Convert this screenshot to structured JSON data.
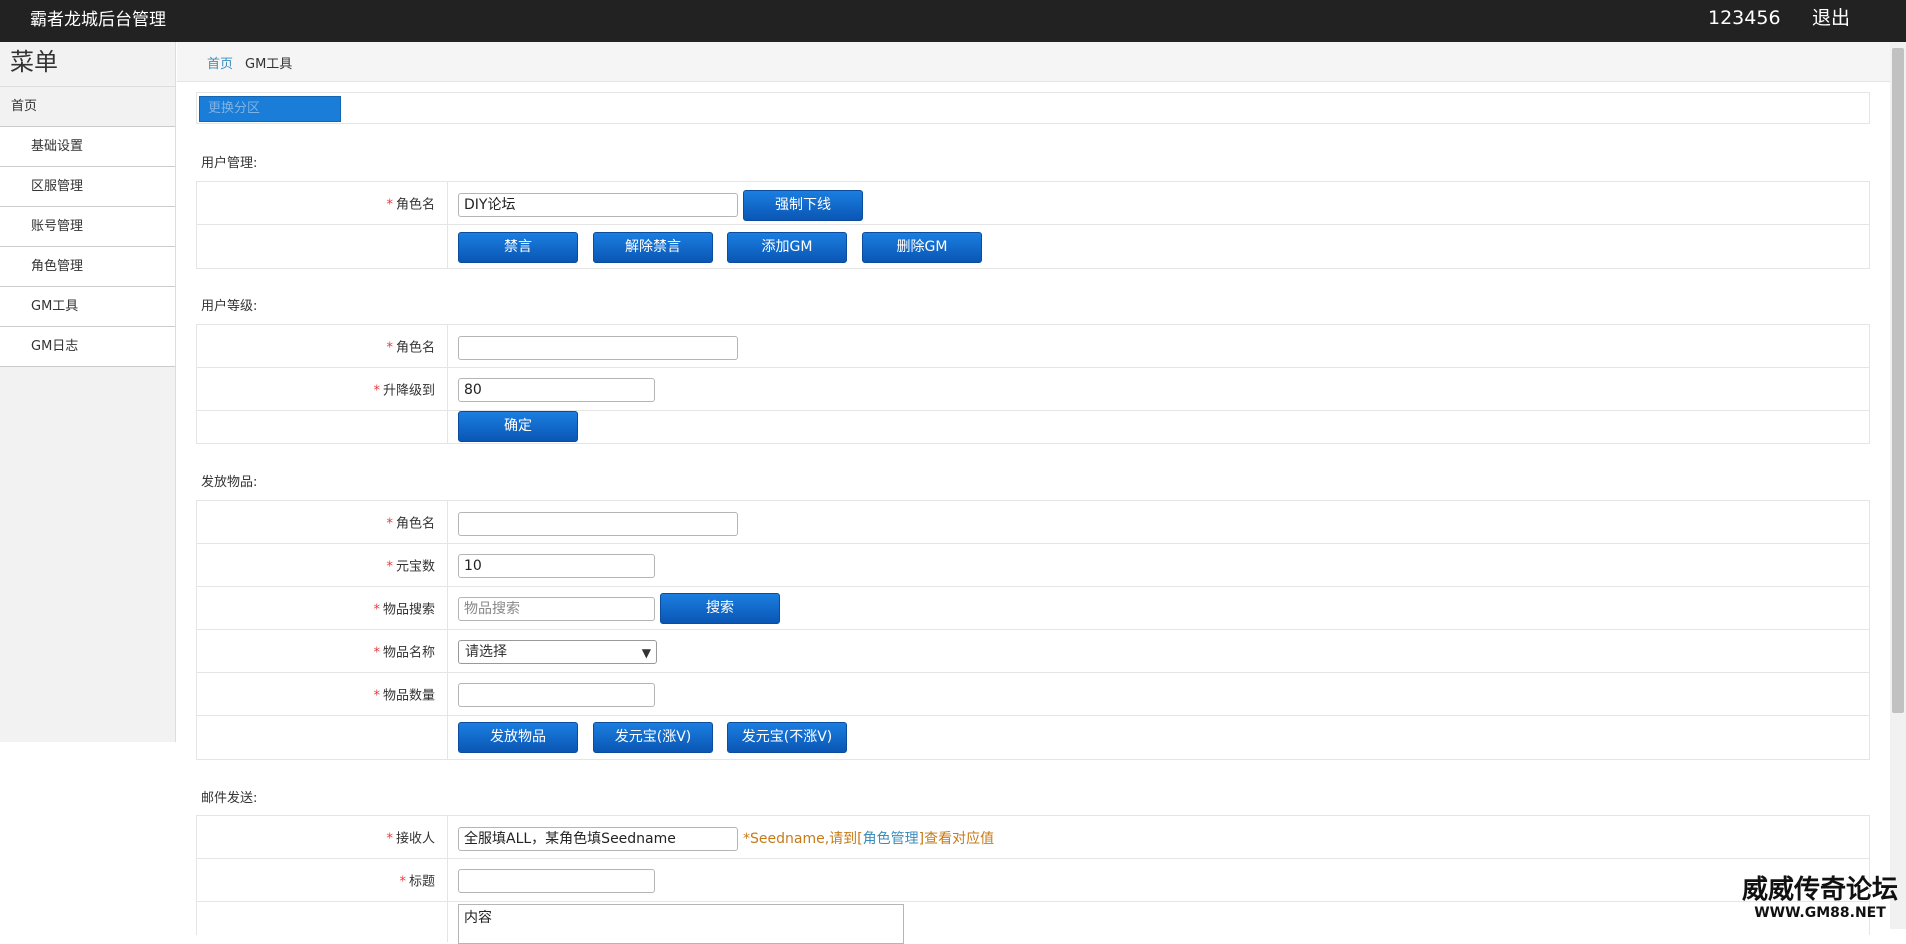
{
  "header": {
    "title": "霸者龙城后台管理",
    "user": "123456",
    "logout": "退出"
  },
  "sidebar": {
    "menu_title": "菜单",
    "home": "首页",
    "items": [
      "基础设置",
      "区服管理",
      "账号管理",
      "角色管理",
      "GM工具",
      "GM日志"
    ]
  },
  "breadcrumb": {
    "home": "首页",
    "current": "GM工具"
  },
  "region": {
    "button": "更换分区"
  },
  "user_manage": {
    "section": "用户管理:",
    "role_label": "角色名",
    "role_value": "DIY论坛",
    "kick_btn": "强制下线",
    "mute_btn": "禁言",
    "unmute_btn": "解除禁言",
    "add_gm_btn": "添加GM",
    "del_gm_btn": "删除GM"
  },
  "user_level": {
    "section": "用户等级:",
    "role_label": "角色名",
    "role_value": "",
    "level_label": "升降级到",
    "level_value": "80",
    "confirm_btn": "确定"
  },
  "items": {
    "section": "发放物品:",
    "role_label": "角色名",
    "role_value": "",
    "yuanbao_label": "元宝数",
    "yuanbao_value": "10",
    "search_label": "物品搜索",
    "search_placeholder": "物品搜索",
    "search_btn": "搜索",
    "name_label": "物品名称",
    "name_select": "请选择",
    "qty_label": "物品数量",
    "qty_value": "",
    "give_btn": "发放物品",
    "yuanbao_v_btn": "发元宝(涨V)",
    "yuanbao_nov_btn": "发元宝(不涨V)"
  },
  "mail": {
    "section": "邮件发送:",
    "receiver_label": "接收人",
    "receiver_value": "全服填ALL，某角色填Seedname",
    "hint_prefix": "*Seedname,请到[",
    "hint_link": "角色管理",
    "hint_suffix": "]查看对应值",
    "title_label": "标题",
    "title_value": "",
    "content_value": "内容"
  },
  "watermark": {
    "title": "威威传奇论坛",
    "url": "WWW.GM88.NET"
  }
}
